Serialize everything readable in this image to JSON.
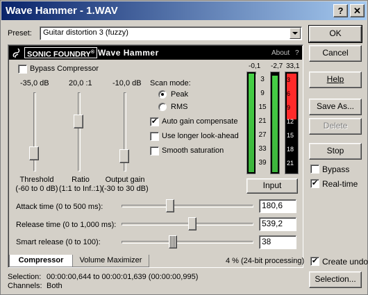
{
  "window": {
    "title": "Wave Hammer - 1.WAV",
    "help_btn": "?",
    "close_btn": "✕"
  },
  "preset": {
    "label": "Preset:",
    "value": "Guitar distortion 3 (fuzzy)"
  },
  "header": {
    "brand": "SONIC FOUNDRY",
    "brand_mark": "®",
    "plugin_name": "Wave Hammer",
    "about": "About",
    "about_q": "?"
  },
  "bypass_compressor": {
    "label": "Bypass Compressor",
    "checked": false
  },
  "sliders": {
    "threshold": {
      "value": "-35,0 dB",
      "label1": "Threshold",
      "label2": "(-60 to 0 dB)"
    },
    "ratio": {
      "value": "20,0 :1",
      "label1": "Ratio",
      "label2": "(1:1 to Inf.:1)"
    },
    "output_gain": {
      "value": "-10,0 dB",
      "label1": "Output gain",
      "label2": "(-30 to 30 dB)"
    }
  },
  "scan_mode": {
    "label": "Scan mode:",
    "peak": "Peak",
    "rms": "RMS",
    "selected": "Peak"
  },
  "options": {
    "auto_gain": {
      "label": "Auto gain compensate",
      "checked": true
    },
    "longer_lookahead": {
      "label": "Use longer look-ahead",
      "checked": false
    },
    "smooth_saturation": {
      "label": "Smooth saturation",
      "checked": false
    }
  },
  "meters": {
    "left_peak": "-0,1",
    "right_peak": "-2,7",
    "gain_reduction_peak": "33,1",
    "level_scale": [
      "3",
      "9",
      "15",
      "21",
      "27",
      "33",
      "39"
    ],
    "gr_scale": [
      "3",
      "6",
      "9",
      "12",
      "15",
      "18",
      "21"
    ],
    "input_button": "Input",
    "left_level_fraction": 1.0,
    "right_level_fraction": 0.98,
    "gr_fraction": 0.85
  },
  "params": {
    "attack": {
      "label": "Attack time (0 to 500 ms):",
      "value": "180,6",
      "fraction": 0.36
    },
    "release": {
      "label": "Release time (0 to 1,000 ms):",
      "value": "539,2",
      "fraction": 0.54
    },
    "smart_release": {
      "label": "Smart release (0 to 100):",
      "value": "38",
      "fraction": 0.38
    }
  },
  "tabs": {
    "compressor": "Compressor",
    "volume_maximizer": "Volume Maximizer",
    "active": "Compressor"
  },
  "status": {
    "text": "4 %  (24-bit processing)"
  },
  "selection": {
    "label": "Selection:",
    "value": "00:00:00,644 to 00:00:01,639 (00:00:00,995)"
  },
  "channels": {
    "label": "Channels:",
    "value": "Both"
  },
  "buttons": {
    "ok": "OK",
    "cancel": "Cancel",
    "help": "Help",
    "save_as": "Save As...",
    "delete": "Delete",
    "stop": "Stop",
    "selection": "Selection..."
  },
  "right_options": {
    "bypass": {
      "label": "Bypass",
      "checked": false
    },
    "realtime": {
      "label": "Real-time",
      "checked": true
    },
    "create_undo": {
      "label": "Create undo",
      "checked": true
    }
  },
  "colors": {
    "titlebar_start": "#0a246a",
    "meter_green": "#46d046",
    "meter_red": "#ff2a2a",
    "header_bg": "#000000"
  }
}
